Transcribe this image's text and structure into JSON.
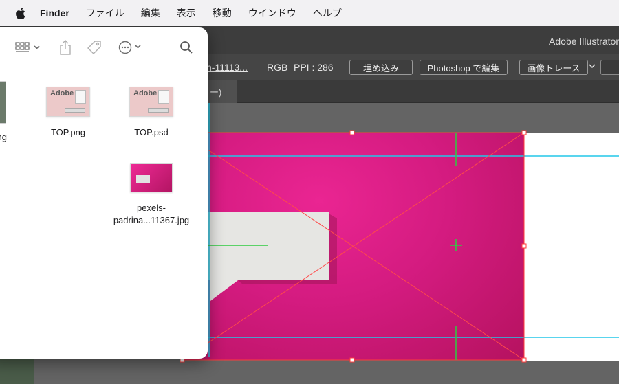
{
  "menubar": {
    "apple": "apple-logo",
    "items": [
      "Finder",
      "ファイル",
      "編集",
      "表示",
      "移動",
      "ウインドウ",
      "ヘルプ"
    ]
  },
  "illustrator": {
    "title": "Adobe Illustrator",
    "control_bar": {
      "file_name": "n-11113...",
      "color_mode": "RGB",
      "ppi": "PPI : 286",
      "embed_button": "埋め込み",
      "photoshop_button": "Photoshop で編集",
      "image_trace_button": "画像トレース"
    },
    "tab_label": "ュー)",
    "accent_colors": {
      "selection": "#ff3b3b",
      "guide": "#22c7e8",
      "smart_guide": "#2ecc40",
      "photo": "#d41b80"
    }
  },
  "finder": {
    "toolbar_icons": [
      "view-grid-icon",
      "share-icon",
      "tag-icon",
      "more-icon",
      "search-icon"
    ],
    "partial_name": "ng",
    "files": [
      {
        "name": "TOP.png",
        "thumb_text": "Adobe"
      },
      {
        "name": "TOP.psd",
        "thumb_text": "Adobe"
      },
      {
        "name": "pexels-\npadrina...11367.jpg"
      }
    ]
  }
}
